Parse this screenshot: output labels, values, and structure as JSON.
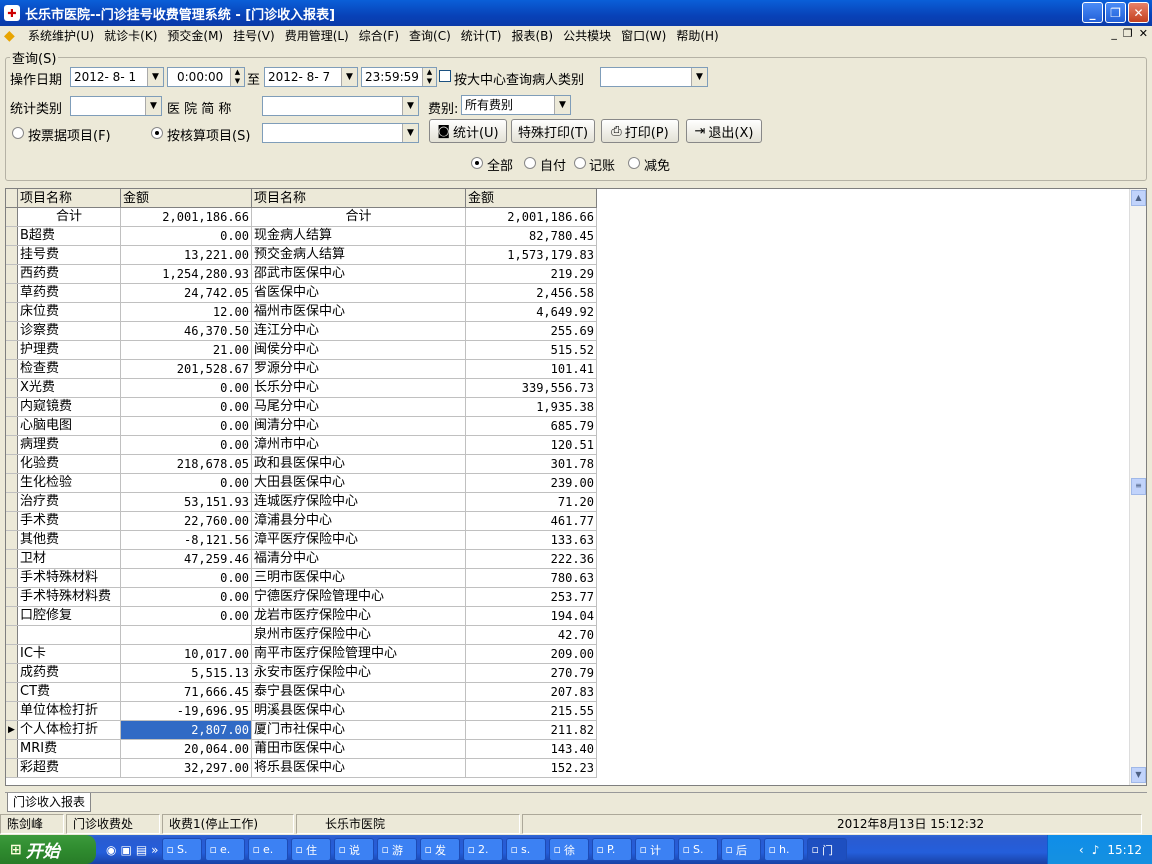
{
  "window": {
    "title": "长乐市医院--门诊挂号收费管理系统 - [门诊收入报表]"
  },
  "menu": [
    "系统维护(U)",
    "就诊卡(K)",
    "预交金(M)",
    "挂号(V)",
    "费用管理(L)",
    "综合(F)",
    "查询(C)",
    "统计(T)",
    "报表(B)",
    "公共模块",
    "窗口(W)",
    "帮助(H)"
  ],
  "query": {
    "legend": "查询(S)",
    "op_date_label": "操作日期",
    "date_from": "2012- 8- 1",
    "time_from": "0:00:00",
    "to_label": "至",
    "date_to": "2012- 8- 7",
    "time_to": "23:59:59",
    "center_check_label": "按大中心查询病人类别",
    "stat_type_label": "统计类别",
    "hospital_label": "医 院 简 称",
    "fee_type_label": "费别:",
    "fee_type_value": "所有费别",
    "by_receipt_label": "按票据项目(F)",
    "by_account_label": "按核算项目(S)",
    "btn_stat": "统计(U)",
    "btn_special_print": "特殊打印(T)",
    "btn_print": "打印(P)",
    "btn_exit": "退出(X)",
    "pay_options": [
      "全部",
      "自付",
      "记账",
      "减免"
    ]
  },
  "table": {
    "headers": [
      "项目名称",
      "金额",
      "项目名称",
      "金额"
    ],
    "rows": [
      [
        "合计",
        "2,001,186.66",
        "合计",
        "2,001,186.66"
      ],
      [
        "B超费",
        "0.00",
        "现金病人结算",
        "82,780.45"
      ],
      [
        "挂号费",
        "13,221.00",
        "预交金病人结算",
        "1,573,179.83"
      ],
      [
        "西药费",
        "1,254,280.93",
        "邵武市医保中心",
        "219.29"
      ],
      [
        "草药费",
        "24,742.05",
        "省医保中心",
        "2,456.58"
      ],
      [
        "床位费",
        "12.00",
        "福州市医保中心",
        "4,649.92"
      ],
      [
        "诊察费",
        "46,370.50",
        "连江分中心",
        "255.69"
      ],
      [
        "护理费",
        "21.00",
        "闽侯分中心",
        "515.52"
      ],
      [
        "检查费",
        "201,528.67",
        "罗源分中心",
        "101.41"
      ],
      [
        "X光费",
        "0.00",
        "长乐分中心",
        "339,556.73"
      ],
      [
        "内窥镜费",
        "0.00",
        "马尾分中心",
        "1,935.38"
      ],
      [
        "心脑电图",
        "0.00",
        "闽清分中心",
        "685.79"
      ],
      [
        "病理费",
        "0.00",
        "漳州市中心",
        "120.51"
      ],
      [
        "化验费",
        "218,678.05",
        "政和县医保中心",
        "301.78"
      ],
      [
        "生化检验",
        "0.00",
        "大田县医保中心",
        "239.00"
      ],
      [
        "治疗费",
        "53,151.93",
        "连城医疗保险中心",
        "71.20"
      ],
      [
        "手术费",
        "22,760.00",
        "漳浦县分中心",
        "461.77"
      ],
      [
        "其他费",
        "-8,121.56",
        "漳平医疗保险中心",
        "133.63"
      ],
      [
        "卫材",
        "47,259.46",
        "福清分中心",
        "222.36"
      ],
      [
        "手术特殊材料",
        "0.00",
        "三明市医保中心",
        "780.63"
      ],
      [
        "手术特殊材料费",
        "0.00",
        "宁德医疗保险管理中心",
        "253.77"
      ],
      [
        "口腔修复",
        "0.00",
        "龙岩市医疗保险中心",
        "194.04"
      ],
      [
        "",
        "",
        "泉州市医疗保险中心",
        "42.70"
      ],
      [
        "IC卡",
        "10,017.00",
        "南平市医疗保险管理中心",
        "209.00"
      ],
      [
        "成药费",
        "5,515.13",
        "永安市医疗保险中心",
        "270.79"
      ],
      [
        "CT费",
        "71,666.45",
        "泰宁县医保中心",
        "207.83"
      ],
      [
        "单位体检打折",
        "-19,696.95",
        "明溪县医保中心",
        "215.55"
      ],
      [
        "个人体检打折",
        "2,807.00",
        "厦门市社保中心",
        "211.82"
      ],
      [
        "MRI费",
        "20,064.00",
        "莆田市医保中心",
        "143.40"
      ],
      [
        "彩超费",
        "32,297.00",
        "将乐县医保中心",
        "152.23"
      ]
    ]
  },
  "tab_label": "门诊收入报表",
  "status": [
    "陈剑峰",
    "门诊收费处",
    "收费1(停止工作)",
    "长乐市医院",
    "2012年8月13日 15:12:32"
  ],
  "taskbar": {
    "start": "开始",
    "tasks": [
      "S.",
      "e.",
      "e.",
      "住",
      "说",
      "游",
      "发",
      "2.",
      "s.",
      "徐",
      "P.",
      "计",
      "S.",
      "后",
      "h.",
      "门"
    ],
    "clock": "15:12"
  }
}
